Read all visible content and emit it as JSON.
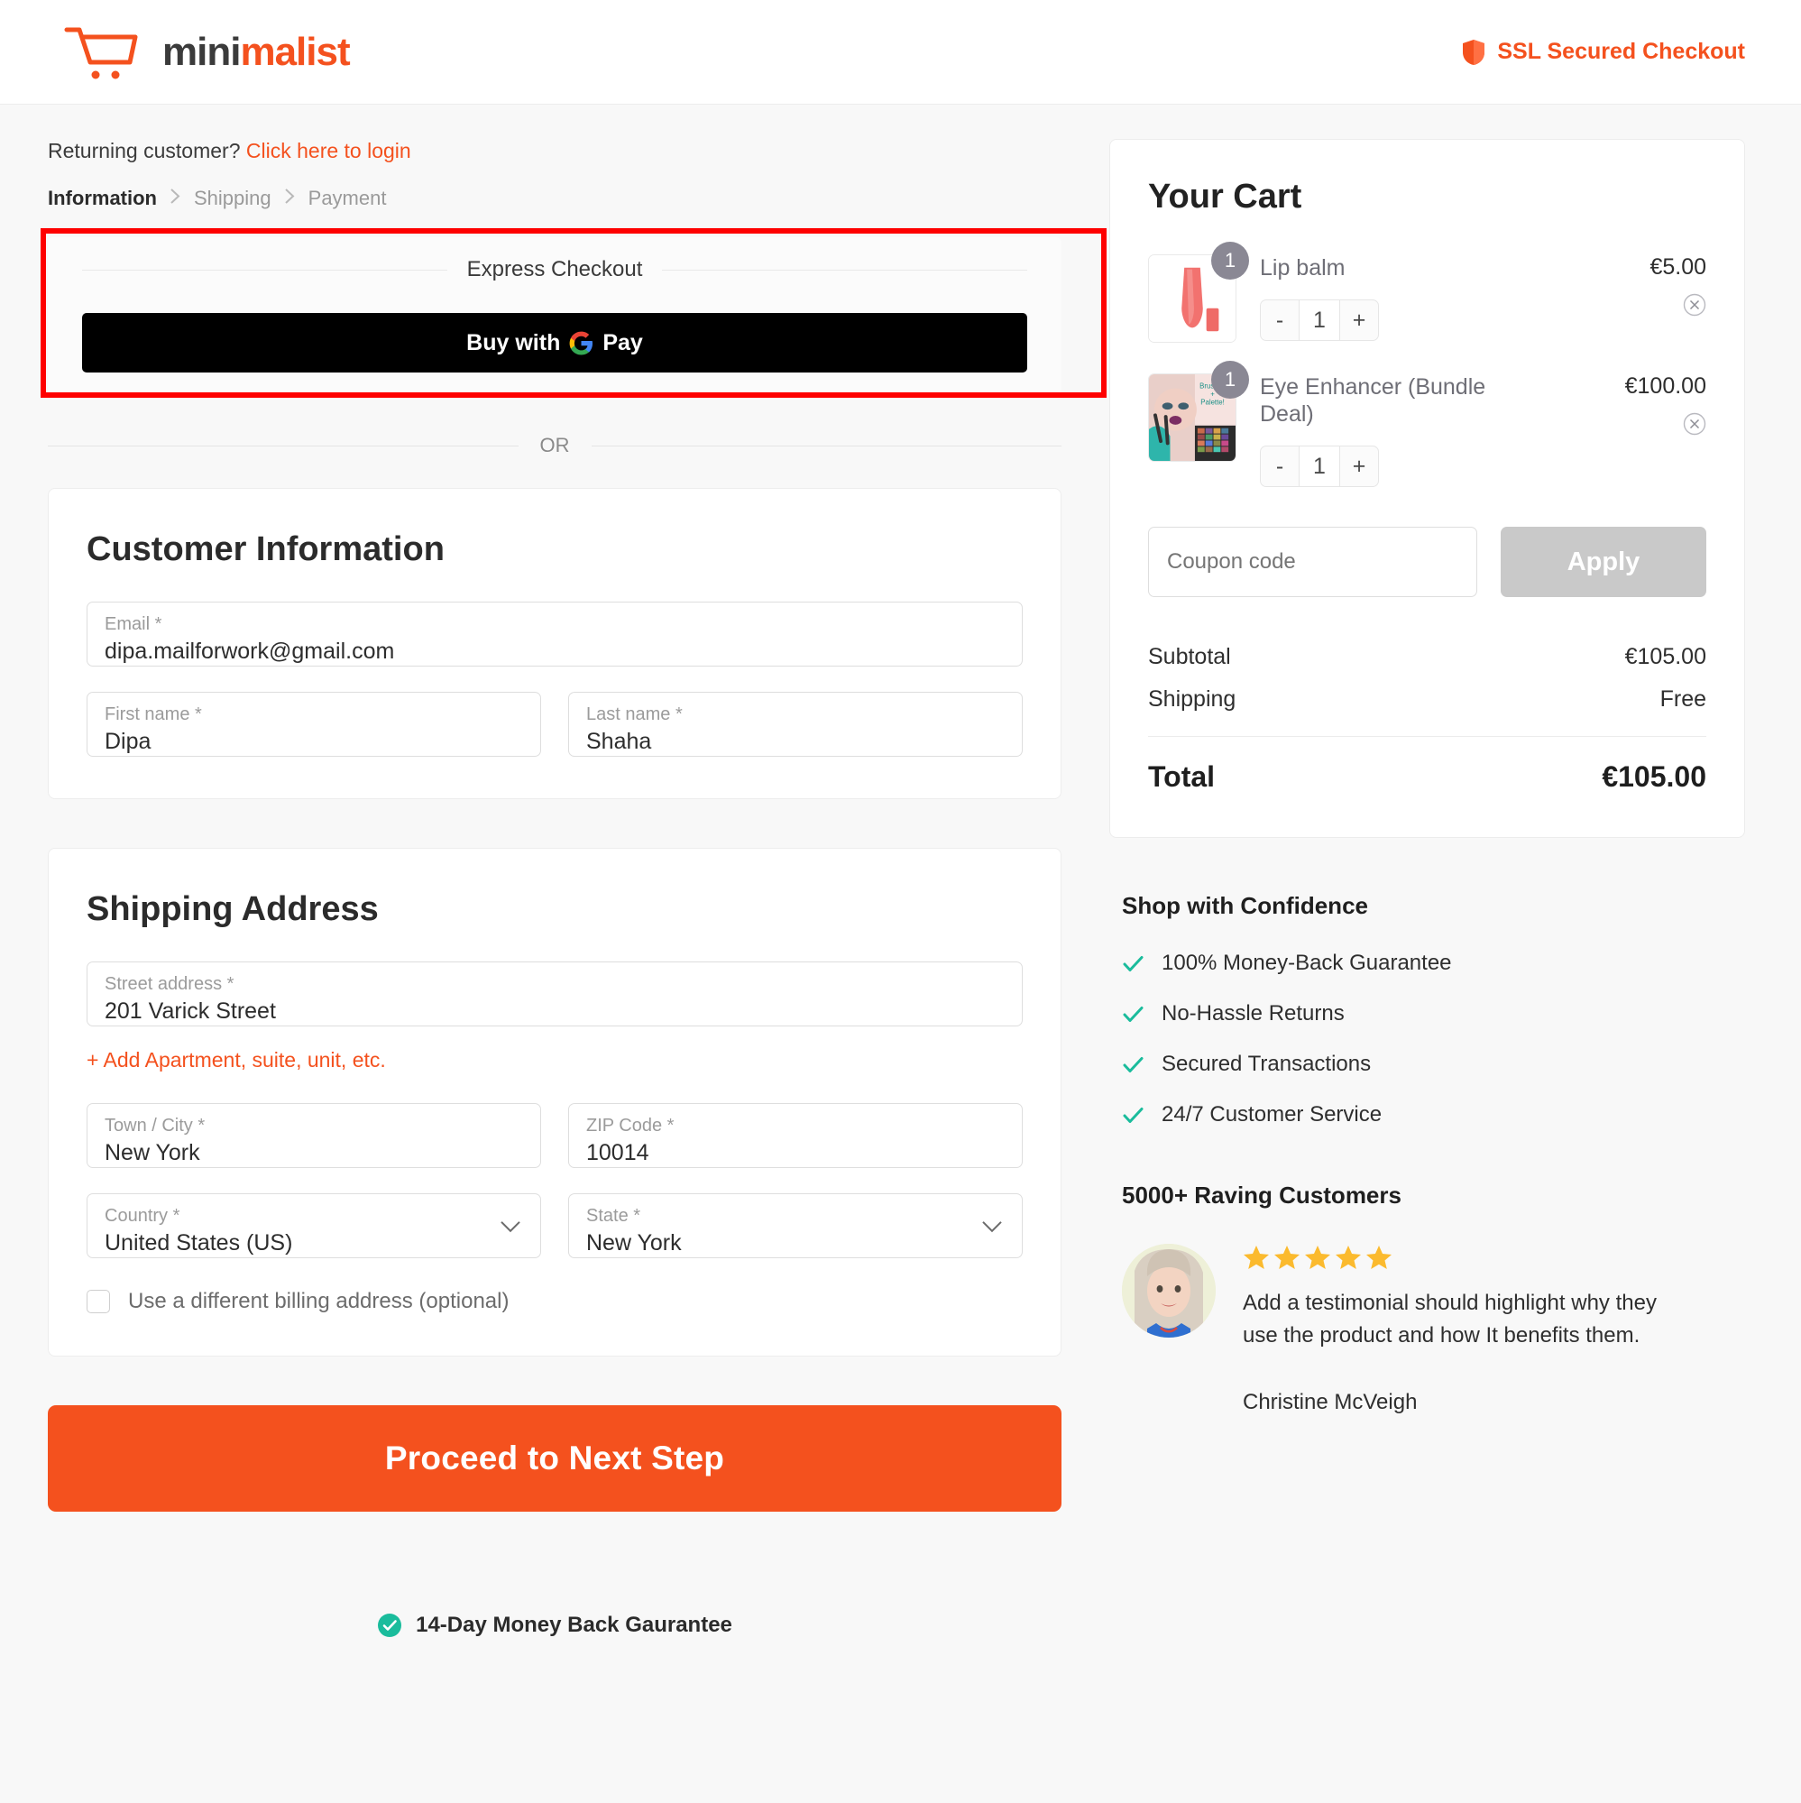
{
  "header": {
    "logo_mini": "mini",
    "logo_malist": "malist",
    "cart_icon": "shopping-cart-icon",
    "ssl_text": "SSL Secured Checkout",
    "ssl_icon": "shield-icon",
    "accent_color": "#f4511e"
  },
  "login_prompt": {
    "text": "Returning customer?",
    "link": "Click here to login"
  },
  "breadcrumb": {
    "steps": [
      {
        "label": "Information",
        "active": true
      },
      {
        "label": "Shipping",
        "active": false
      },
      {
        "label": "Payment",
        "active": false
      }
    ],
    "separator": "›"
  },
  "express": {
    "title": "Express Checkout",
    "gpay_buy_with": "Buy with",
    "gpay_pay": "Pay",
    "gpay_icon": "google-g-icon",
    "annotation_color": "#fe0000"
  },
  "divider": {
    "or": "OR"
  },
  "customer_information": {
    "heading": "Customer Information",
    "email": {
      "label": "Email *",
      "value": "dipa.mailforwork@gmail.com",
      "placeholder": "Email *"
    },
    "first_name": {
      "label": "First name *",
      "value": "Dipa",
      "placeholder": "First name *"
    },
    "last_name": {
      "label": "Last name *",
      "value": "Shaha",
      "placeholder": "Last name *"
    }
  },
  "shipping_address": {
    "heading": "Shipping Address",
    "street": {
      "label": "Street address *",
      "value": "201 Varick Street",
      "placeholder": "Street address *"
    },
    "add_apartment_link": "+ Add Apartment, suite, unit, etc.",
    "city": {
      "label": "Town / City *",
      "value": "New York",
      "placeholder": "Town / City *"
    },
    "zip": {
      "label": "ZIP Code *",
      "value": "10014",
      "placeholder": "ZIP Code *"
    },
    "country": {
      "label": "Country *",
      "value": "United States (US)"
    },
    "state": {
      "label": "State *",
      "value": "New York"
    },
    "billing_checkbox_label": "Use a different billing address (optional)",
    "billing_checked": false
  },
  "submit": {
    "proceed_label": "Proceed to Next Step",
    "guarantee_text": "14-Day Money Back Gaurantee",
    "guarantee_icon": "check-circle-icon"
  },
  "cart": {
    "heading": "Your Cart",
    "items": [
      {
        "name": "Lip balm",
        "price": "€5.00",
        "badge_qty": "1",
        "qty": "1",
        "minus": "-",
        "plus": "+",
        "thumb": "lip-balm-tube-image",
        "remove_icon": "remove-item-icon"
      },
      {
        "name": "Eye Enhancer (Bundle Deal)",
        "price": "€100.00",
        "badge_qty": "1",
        "qty": "1",
        "minus": "-",
        "plus": "+",
        "thumb": "eye-enhancer-bundle-image",
        "remove_icon": "remove-item-icon"
      }
    ],
    "coupon": {
      "placeholder": "Coupon code",
      "value": "",
      "apply_label": "Apply"
    },
    "totals": {
      "subtotal_label": "Subtotal",
      "subtotal_value": "€105.00",
      "shipping_label": "Shipping",
      "shipping_value": "Free",
      "total_label": "Total",
      "total_value": "€105.00"
    }
  },
  "trust": {
    "heading": "Shop with Confidence",
    "check_color": "#1abc9c",
    "items": [
      "100% Money-Back Guarantee",
      "No-Hassle Returns",
      "Secured Transactions",
      "24/7 Customer Service"
    ]
  },
  "testimonial": {
    "heading": "5000+ Raving Customers",
    "stars": 5,
    "star_color": "#fbba2e",
    "text": "Add a testimonial should highlight why they use the product and how It benefits them.",
    "author": "Christine McVeigh",
    "avatar": "customer-avatar-image"
  }
}
